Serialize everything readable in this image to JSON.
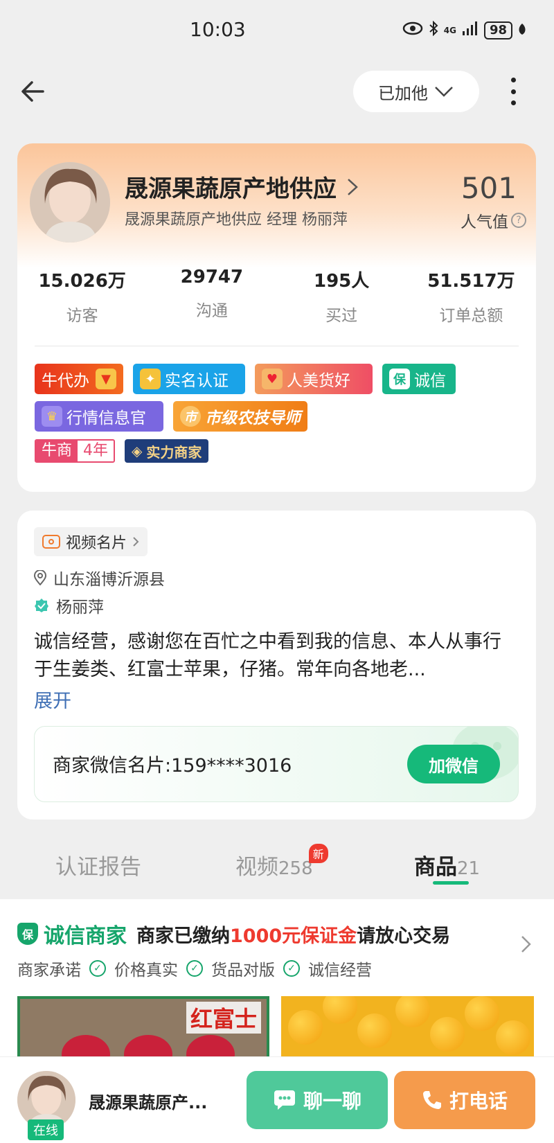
{
  "status_bar": {
    "time": "10:03",
    "network": "4G",
    "battery": "98"
  },
  "nav": {
    "follow_label": "已加他"
  },
  "profile": {
    "shop_name": "晟源果蔬原产地供应",
    "subtitle": "晟源果蔬原产地供应  经理  杨丽萍",
    "popularity_value": "501",
    "popularity_label": "人气值",
    "stats": [
      {
        "value": "15.026万",
        "label": "访客"
      },
      {
        "value": "29747",
        "label": "沟通"
      },
      {
        "value": "195人",
        "label": "买过"
      },
      {
        "value": "51.517万",
        "label": "订单总额"
      }
    ],
    "badges": {
      "niudaiban": "牛代办",
      "shiming": "实名认证",
      "renmei": "人美货好",
      "chengxin": "诚信",
      "hangqing": "行情信息官",
      "shiji_icon": "市",
      "shiji": "市级农技导师",
      "niushang": "牛商",
      "niushang_years": "4年",
      "shili": "实力商家"
    }
  },
  "info": {
    "video_card": "视频名片",
    "location": "山东淄博沂源县",
    "name": "杨丽萍",
    "description": "诚信经营，感谢您在百忙之中看到我的信息、本人从事行于生姜类、红富士苹果，仔猪。常年向各地老...",
    "expand": "展开",
    "wechat_text": "商家微信名片:159****3016",
    "wechat_button": "加微信"
  },
  "tabs": [
    {
      "label": "认证报告",
      "count": ""
    },
    {
      "label": "视频",
      "count": "258",
      "badge": "新"
    },
    {
      "label": "商品",
      "count": "21"
    }
  ],
  "guarantee": {
    "shield": "保",
    "title": "诚信商家",
    "text_pre": "商家已缴纳",
    "text_amount": "1000元保证金",
    "text_post": "请放心交易",
    "promise_label": "商家承诺",
    "promises": [
      "价格真实",
      "货品对版",
      "诚信经营"
    ]
  },
  "products": {
    "p1_label": "红富士"
  },
  "bottom": {
    "online": "在线",
    "name": "晟源果蔬原产...",
    "chat": "聊一聊",
    "call": "打电话"
  },
  "colors": {
    "accent_green": "#16b97a",
    "orange": "#f59b4c",
    "red": "#ee3a2f"
  }
}
